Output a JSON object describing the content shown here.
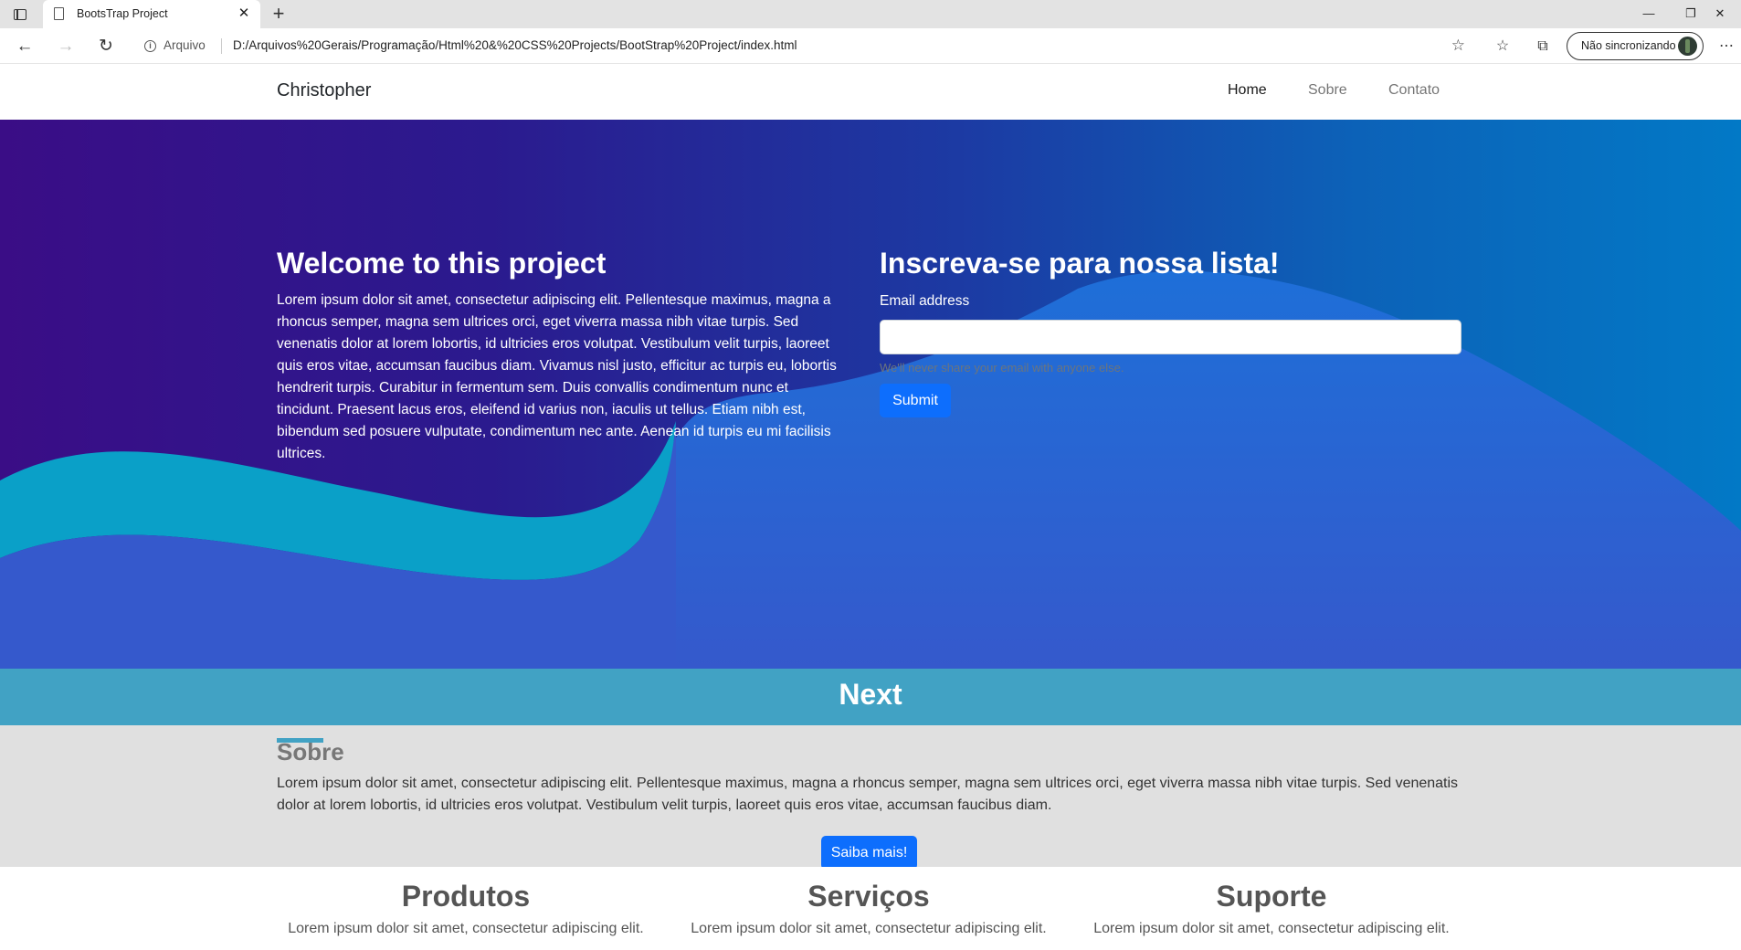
{
  "browser": {
    "tab_title": "BootsTrap Project",
    "tab_close": "✕",
    "new_tab": "+",
    "minimize": "—",
    "restore": "❐",
    "close": "✕",
    "back": "←",
    "forward": "→",
    "reload": "↻",
    "info_glyph": "i",
    "address_scheme": "Arquivo",
    "address_url": "D:/Arquivos%20Gerais/Programação/Html%20&%20CSS%20Projects/BootStrap%20Project/index.html",
    "favorites_add": "☆",
    "favorites": "☆",
    "collections": "⧉",
    "profile_label": "Não sincronizando",
    "more": "⋯"
  },
  "navbar": {
    "brand": "Christopher",
    "links": [
      "Home",
      "Sobre",
      "Contato"
    ]
  },
  "hero": {
    "title": "Welcome to this project",
    "text": "Lorem ipsum dolor sit amet, consectetur adipiscing elit. Pellentesque maximus, magna a rhoncus semper, magna sem ultrices orci, eget viverra massa nibh vitae turpis. Sed venenatis dolor at lorem lobortis, id ultricies eros volutpat. Vestibulum velit turpis, laoreet quis eros vitae, accumsan faucibus diam. Vivamus nisl justo, efficitur ac turpis eu, lobortis hendrerit turpis. Curabitur in fermentum sem. Duis convallis condimentum nunc et tincidunt. Praesent lacus eros, eleifend id varius non, iaculis ut tellus. Etiam nibh est, bibendum sed posuere vulputate, condimentum nec ante. Aenean id turpis eu mi facilisis ultrices."
  },
  "form": {
    "title": "Inscreva-se para nossa lista!",
    "email_label": "Email address",
    "email_value": "",
    "email_help": "We'll never share your email with anyone else.",
    "submit_label": "Submit"
  },
  "next": {
    "title": "Next"
  },
  "about": {
    "title": "Sobre",
    "text": "Lorem ipsum dolor sit amet, consectetur adipiscing elit. Pellentesque maximus, magna a rhoncus semper, magna sem ultrices orci, eget viverra massa nibh vitae turpis. Sed venenatis dolor at lorem lobortis, id ultricies eros volutpat. Vestibulum velit turpis, laoreet quis eros vitae, accumsan faucibus diam.",
    "button_label": "Saiba mais!"
  },
  "services": [
    {
      "title": "Produtos",
      "text": "Lorem ipsum dolor sit amet, consectetur adipiscing elit."
    },
    {
      "title": "Serviços",
      "text": "Lorem ipsum dolor sit amet, consectetur adipiscing elit."
    },
    {
      "title": "Suporte",
      "text": "Lorem ipsum dolor sit amet, consectetur adipiscing elit."
    }
  ],
  "colors": {
    "primary_button": "#0d6efd",
    "accent": "#41a2c4",
    "hero_start": "#3a0d86",
    "hero_end": "#0279c6",
    "wave_pink": "#d85cf0",
    "wave_cyan": "#0aa0c8",
    "about_bg": "#e0e0e0"
  }
}
